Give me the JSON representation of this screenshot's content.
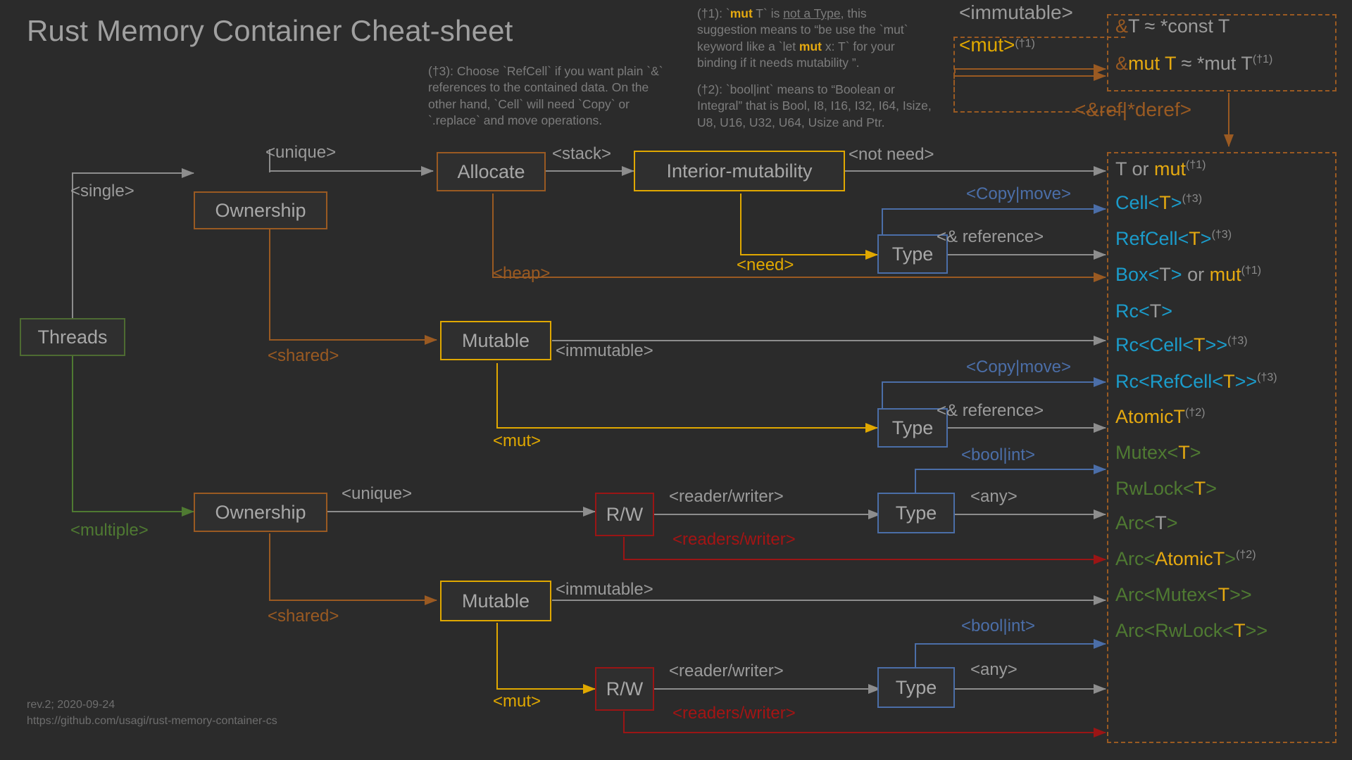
{
  "meta": {
    "title": "Rust Memory Container Cheat-sheet",
    "revision": "rev.2; 2020-09-24",
    "url": "https://github.com/usagi/rust-memory-container-cs",
    "background": "#2b2b2b"
  },
  "palette": {
    "grey": "#9b9b9b",
    "orange": "#9a5a22",
    "gold": "#e0a800",
    "green": "#4f7a32",
    "blue": "#4b6ea8",
    "red": "#a41414",
    "cyan": "#1b9ccb",
    "yellow_text": "#e5a910"
  },
  "notes": {
    "n3": {
      "marker": "(†3):",
      "text": " Choose `RefCell` if you want plain `&` references to the contained data. On the other hand, `Cell` will need `Copy` or `.replace` and move operations."
    },
    "n1": {
      "marker": "(†1):",
      "p1": " `",
      "mut1": "mut",
      "p2": " T` is ",
      "underline": "not a Type",
      "p3": ", this suggestion means to “be use the `mut` keyword like a `let ",
      "mut2": "mut",
      "p4": " x: T` for your binding if it needs mutability ”."
    },
    "n2": {
      "marker": "(†2):",
      "text": " `bool|int` means to “Boolean or Integral” that is Bool, I8, I16, I32, I64, Isize, U8, U16, U32, U64,  Usize and Ptr."
    }
  },
  "ref_panel": {
    "immutable_label": "<immutable>",
    "mut_label": "<mut>",
    "mut_sup": "(†1)",
    "deref_label": "<&ref|*deref>",
    "rows": [
      {
        "amp": "&",
        "mid": "T",
        "rest": " ≈ *const T",
        "sup": ""
      },
      {
        "amp": "&",
        "mid": "mut T",
        "rest": " ≈ *mut T",
        "sup": "(†1)"
      }
    ]
  },
  "nodes": {
    "threads": "Threads",
    "ownership_single": "Ownership",
    "ownership_multiple": "Ownership",
    "allocate": "Allocate",
    "interior_mutability": "Interior-mutability",
    "mutable_single": "Mutable",
    "mutable_multiple": "Mutable",
    "type_1": "Type",
    "type_2": "Type",
    "type_3": "Type",
    "type_4": "Type",
    "rw_1": "R/W",
    "rw_2": "R/W"
  },
  "edges": {
    "single": "<single>",
    "multiple": "<multiple>",
    "unique_top": "<unique>",
    "unique_bottom": "<unique>",
    "shared_top": "<shared>",
    "shared_bottom": "<shared>",
    "stack": "<stack>",
    "heap": "<heap>",
    "not_need": "<not need>",
    "need": "<need>",
    "immutable_top": "<immutable>",
    "immutable_bottom": "<immutable>",
    "mut_top": "<mut>",
    "mut_bottom": "<mut>",
    "copy_move_1": "<Copy|move>",
    "copy_move_2": "<Copy|move>",
    "reference_1": "<& reference>",
    "reference_2": "<& reference>",
    "bool_int_1": "<bool|int>",
    "bool_int_2": "<bool|int>",
    "any_1": "<any>",
    "any_2": "<any>",
    "reader_writer_1": "<reader/writer>",
    "reader_writer_2": "<reader/writer>",
    "readers_writer_1": "<readers/writer>",
    "readers_writer_2": "<readers/writer>"
  },
  "outputs": [
    {
      "id": "t-or-mut",
      "parts": [
        {
          "t": "T or ",
          "c": "grey"
        },
        {
          "t": "mut",
          "c": "gold"
        }
      ],
      "sup": "(†1)"
    },
    {
      "id": "cell",
      "parts": [
        {
          "t": "Cell<",
          "c": "cyan"
        },
        {
          "t": "T",
          "c": "gold"
        },
        {
          "t": ">",
          "c": "cyan"
        }
      ],
      "sup": "(†3)"
    },
    {
      "id": "refcell",
      "parts": [
        {
          "t": "RefCell<",
          "c": "cyan"
        },
        {
          "t": "T",
          "c": "gold"
        },
        {
          "t": ">",
          "c": "cyan"
        }
      ],
      "sup": "(†3)"
    },
    {
      "id": "box-or-mut",
      "parts": [
        {
          "t": "Box<",
          "c": "cyan"
        },
        {
          "t": "T",
          "c": "grey"
        },
        {
          "t": ">",
          "c": "cyan"
        },
        {
          "t": " or ",
          "c": "grey"
        },
        {
          "t": "mut",
          "c": "gold"
        }
      ],
      "sup": "(†1)"
    },
    {
      "id": "rc",
      "parts": [
        {
          "t": "Rc<",
          "c": "cyan"
        },
        {
          "t": "T",
          "c": "grey"
        },
        {
          "t": ">",
          "c": "cyan"
        }
      ],
      "sup": ""
    },
    {
      "id": "rc-cell",
      "parts": [
        {
          "t": "Rc<Cell<",
          "c": "cyan"
        },
        {
          "t": "T",
          "c": "gold"
        },
        {
          "t": ">>",
          "c": "cyan"
        }
      ],
      "sup": "(†3)"
    },
    {
      "id": "rc-refcell",
      "parts": [
        {
          "t": "Rc<RefCell<",
          "c": "cyan"
        },
        {
          "t": "T",
          "c": "gold"
        },
        {
          "t": ">>",
          "c": "cyan"
        }
      ],
      "sup": "(†3)"
    },
    {
      "id": "atomict",
      "parts": [
        {
          "t": "AtomicT",
          "c": "gold"
        }
      ],
      "sup": "(†2)"
    },
    {
      "id": "mutex",
      "parts": [
        {
          "t": "Mutex<",
          "c": "green"
        },
        {
          "t": "T",
          "c": "gold"
        },
        {
          "t": ">",
          "c": "green"
        }
      ],
      "sup": ""
    },
    {
      "id": "rwlock",
      "parts": [
        {
          "t": "RwLock<",
          "c": "green"
        },
        {
          "t": "T",
          "c": "gold"
        },
        {
          "t": ">",
          "c": "green"
        }
      ],
      "sup": ""
    },
    {
      "id": "arc",
      "parts": [
        {
          "t": "Arc<",
          "c": "green"
        },
        {
          "t": "T",
          "c": "grey"
        },
        {
          "t": ">",
          "c": "green"
        }
      ],
      "sup": ""
    },
    {
      "id": "arc-atomict",
      "parts": [
        {
          "t": "Arc<",
          "c": "green"
        },
        {
          "t": "AtomicT",
          "c": "gold"
        },
        {
          "t": ">",
          "c": "green"
        }
      ],
      "sup": "(†2)"
    },
    {
      "id": "arc-mutex",
      "parts": [
        {
          "t": "Arc<Mutex<",
          "c": "green"
        },
        {
          "t": "T",
          "c": "gold"
        },
        {
          "t": ">>",
          "c": "green"
        }
      ],
      "sup": ""
    },
    {
      "id": "arc-rwlock",
      "parts": [
        {
          "t": "Arc<RwLock<",
          "c": "green"
        },
        {
          "t": "T",
          "c": "gold"
        },
        {
          "t": ">>",
          "c": "green"
        }
      ],
      "sup": ""
    }
  ]
}
